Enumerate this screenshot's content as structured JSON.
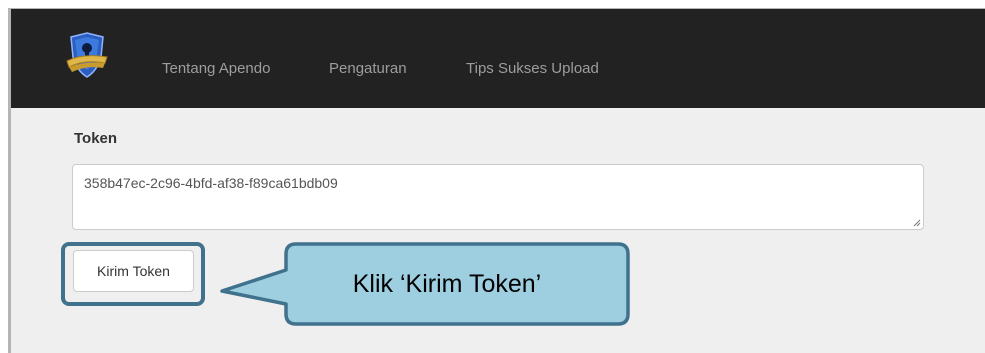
{
  "navbar": {
    "items": [
      {
        "label": "Tentang Apendo"
      },
      {
        "label": "Pengaturan"
      },
      {
        "label": "Tips Sukses Upload"
      }
    ],
    "logo_icon": "shield-key-logo-icon"
  },
  "form": {
    "token_label": "Token",
    "token_value": "358b47ec-2c96-4bfd-af38-f89ca61bdb09",
    "submit_label": "Kirim Token"
  },
  "callout": {
    "text": "Klik ‘Kirim Token’"
  },
  "colors": {
    "navbar_bg": "#222222",
    "nav_text": "#9d9d9d",
    "content_bg": "#efefef",
    "callout_fill": "#9dcfe0",
    "callout_border": "#41728d"
  }
}
